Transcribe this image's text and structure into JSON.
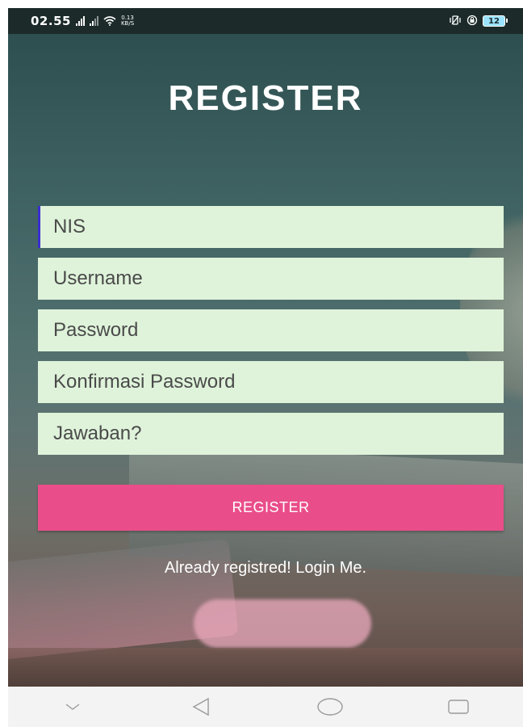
{
  "status_bar": {
    "time": "02.55",
    "net_speed_value": "0.13",
    "net_speed_unit": "KB/S",
    "battery_level": "12"
  },
  "icons": {
    "signal": "signal-icon",
    "wifi": "wifi-icon",
    "vibrate": "vibrate-icon",
    "rotation_lock": "rotation-lock-icon",
    "battery": "battery-icon",
    "nav_collapse": "chevron-down-icon",
    "nav_back": "back-triangle-icon",
    "nav_home": "home-circle-icon",
    "nav_recents": "recents-square-icon"
  },
  "page": {
    "title": "REGISTER"
  },
  "form": {
    "nis_placeholder": "NIS",
    "username_placeholder": "Username",
    "password_placeholder": "Password",
    "confirm_password_placeholder": "Konfirmasi Password",
    "answer_placeholder": "Jawaban?"
  },
  "actions": {
    "register_label": "REGISTER",
    "login_link": "Already registred! Login Me."
  },
  "colors": {
    "field_bg": "#dff3da",
    "button_bg": "#e94e8a",
    "status_bar_bg": "#1c2a2a"
  }
}
